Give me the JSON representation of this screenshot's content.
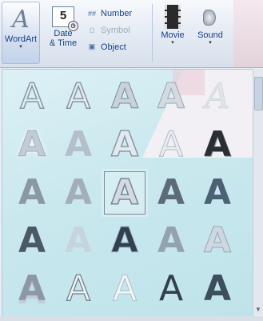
{
  "ribbon": {
    "wordart": {
      "label": "WordArt",
      "glyph": "A",
      "arrow": "▾"
    },
    "datetime": {
      "label_line1": "Date",
      "label_line2": "& Time",
      "calendar_digit": "5"
    },
    "number": {
      "label": "Number",
      "icon": "##"
    },
    "symbol": {
      "label": "Symbol",
      "icon": "Ω"
    },
    "object": {
      "label": "Object",
      "icon": "▣"
    },
    "movie": {
      "label": "Movie",
      "arrow": "▾"
    },
    "sound": {
      "label": "Sound",
      "arrow": "▾"
    }
  },
  "gallery": {
    "glyph": "A",
    "selected_index": 12,
    "styles": [
      "s1",
      "s2",
      "s3",
      "s4",
      "s5",
      "s6",
      "s7",
      "s8",
      "s9",
      "s10",
      "s11",
      "s12",
      "s13",
      "s14",
      "s15",
      "s16",
      "s17",
      "s18",
      "s19",
      "s20",
      "s21",
      "s22",
      "s23",
      "s24",
      "s25"
    ]
  }
}
